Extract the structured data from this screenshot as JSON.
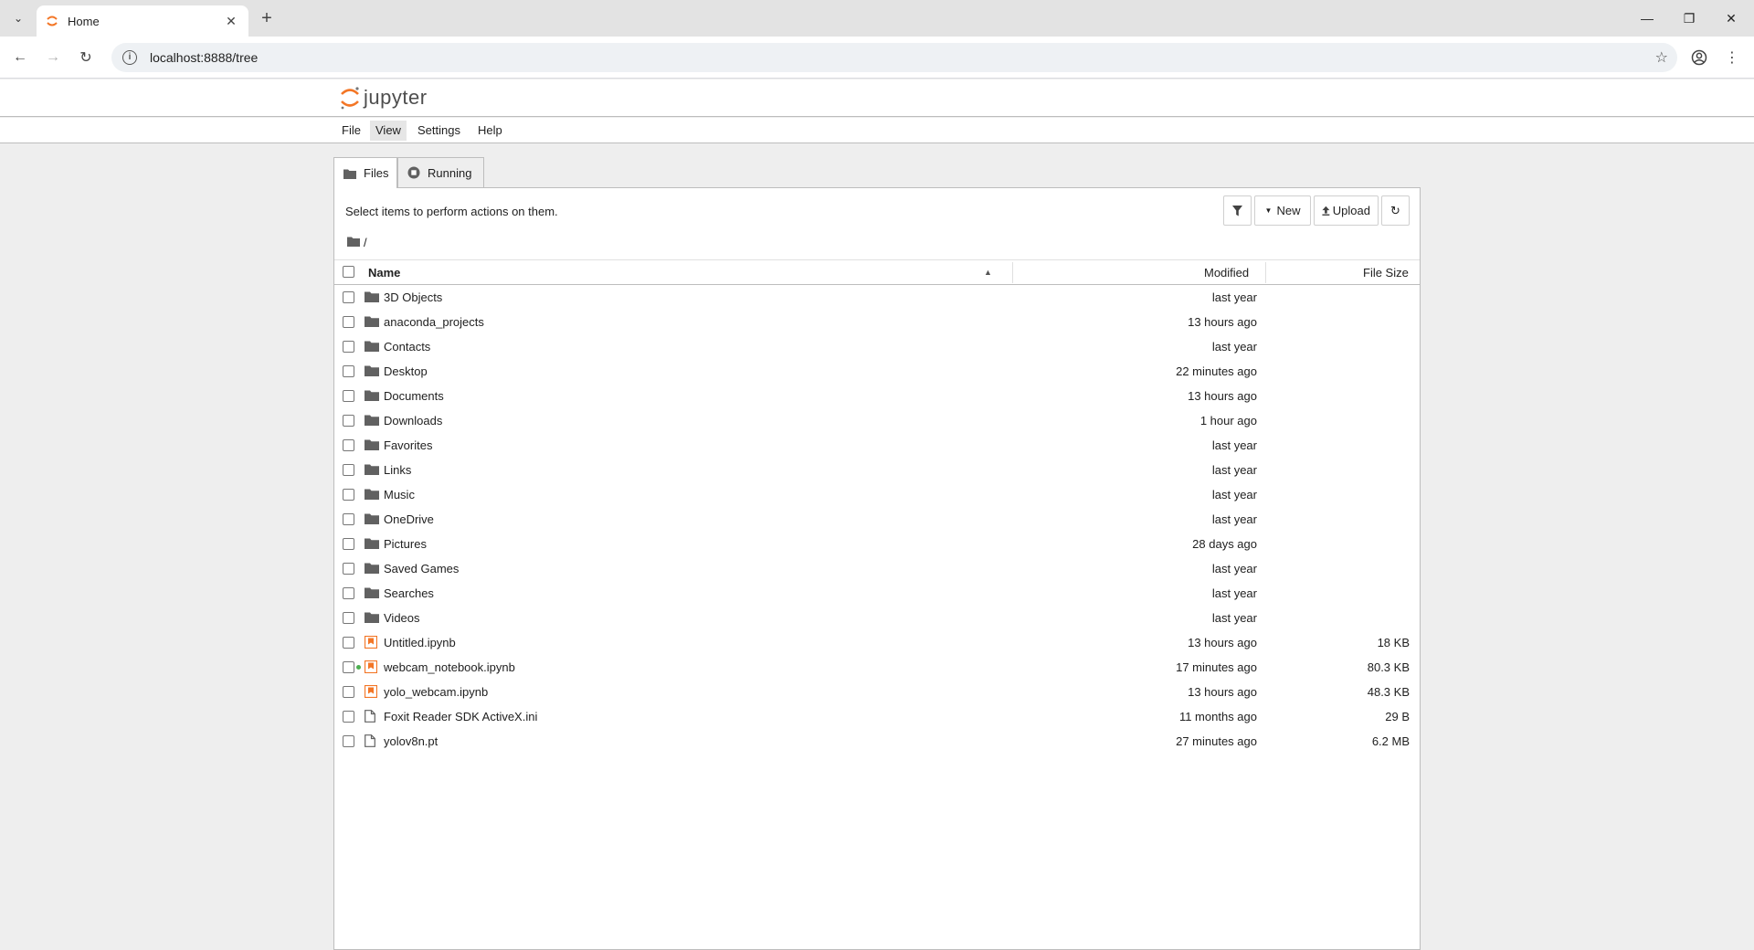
{
  "browser": {
    "tab_title": "Home",
    "url": "localhost:8888/tree"
  },
  "jupyter": {
    "logo_text": "jupyter",
    "menu": [
      {
        "label": "File"
      },
      {
        "label": "View"
      },
      {
        "label": "Settings"
      },
      {
        "label": "Help"
      }
    ],
    "tabs": [
      {
        "label": "Files"
      },
      {
        "label": "Running"
      }
    ],
    "hint": "Select items to perform actions on them.",
    "toolbar": {
      "new_label": "New",
      "upload_label": "Upload"
    },
    "breadcrumb": "/",
    "columns": {
      "name": "Name",
      "modified": "Modified",
      "size": "File Size"
    },
    "files": [
      {
        "name": "3D Objects",
        "type": "folder",
        "modified": "last year",
        "size": ""
      },
      {
        "name": "anaconda_projects",
        "type": "folder",
        "modified": "13 hours ago",
        "size": ""
      },
      {
        "name": "Contacts",
        "type": "folder",
        "modified": "last year",
        "size": ""
      },
      {
        "name": "Desktop",
        "type": "folder",
        "modified": "22 minutes ago",
        "size": ""
      },
      {
        "name": "Documents",
        "type": "folder",
        "modified": "13 hours ago",
        "size": ""
      },
      {
        "name": "Downloads",
        "type": "folder",
        "modified": "1 hour ago",
        "size": ""
      },
      {
        "name": "Favorites",
        "type": "folder",
        "modified": "last year",
        "size": ""
      },
      {
        "name": "Links",
        "type": "folder",
        "modified": "last year",
        "size": ""
      },
      {
        "name": "Music",
        "type": "folder",
        "modified": "last year",
        "size": ""
      },
      {
        "name": "OneDrive",
        "type": "folder",
        "modified": "last year",
        "size": ""
      },
      {
        "name": "Pictures",
        "type": "folder",
        "modified": "28 days ago",
        "size": ""
      },
      {
        "name": "Saved Games",
        "type": "folder",
        "modified": "last year",
        "size": ""
      },
      {
        "name": "Searches",
        "type": "folder",
        "modified": "last year",
        "size": ""
      },
      {
        "name": "Videos",
        "type": "folder",
        "modified": "last year",
        "size": ""
      },
      {
        "name": "Untitled.ipynb",
        "type": "notebook",
        "modified": "13 hours ago",
        "size": "18 KB"
      },
      {
        "name": "webcam_notebook.ipynb",
        "type": "notebook",
        "running": true,
        "modified": "17 minutes ago",
        "size": "80.3 KB"
      },
      {
        "name": "yolo_webcam.ipynb",
        "type": "notebook",
        "modified": "13 hours ago",
        "size": "48.3 KB"
      },
      {
        "name": "Foxit Reader SDK ActiveX.ini",
        "type": "file",
        "modified": "11 months ago",
        "size": "29 B"
      },
      {
        "name": "yolov8n.pt",
        "type": "file",
        "modified": "27 minutes ago",
        "size": "6.2 MB"
      }
    ],
    "colors": {
      "notebook_orange": "#f37626",
      "running_green": "#4caf50"
    }
  }
}
